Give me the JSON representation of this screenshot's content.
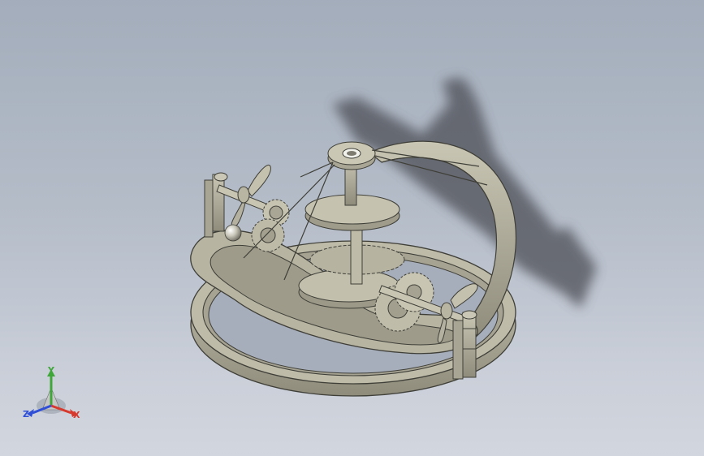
{
  "viewport": {
    "model": "gyroscope-gear-assembly",
    "colors": {
      "background_top": "#a3adbb",
      "background_bottom": "#d2d6de",
      "part_fill": "#b9b6a4",
      "part_edge": "#3f3f38",
      "shadow": "#4e5057"
    }
  },
  "triad": {
    "x_label": "X",
    "y_label": "Y",
    "z_label": "Z",
    "x_color": "#d63a2f",
    "y_color": "#3fa63a",
    "z_color": "#2f4fd6"
  }
}
